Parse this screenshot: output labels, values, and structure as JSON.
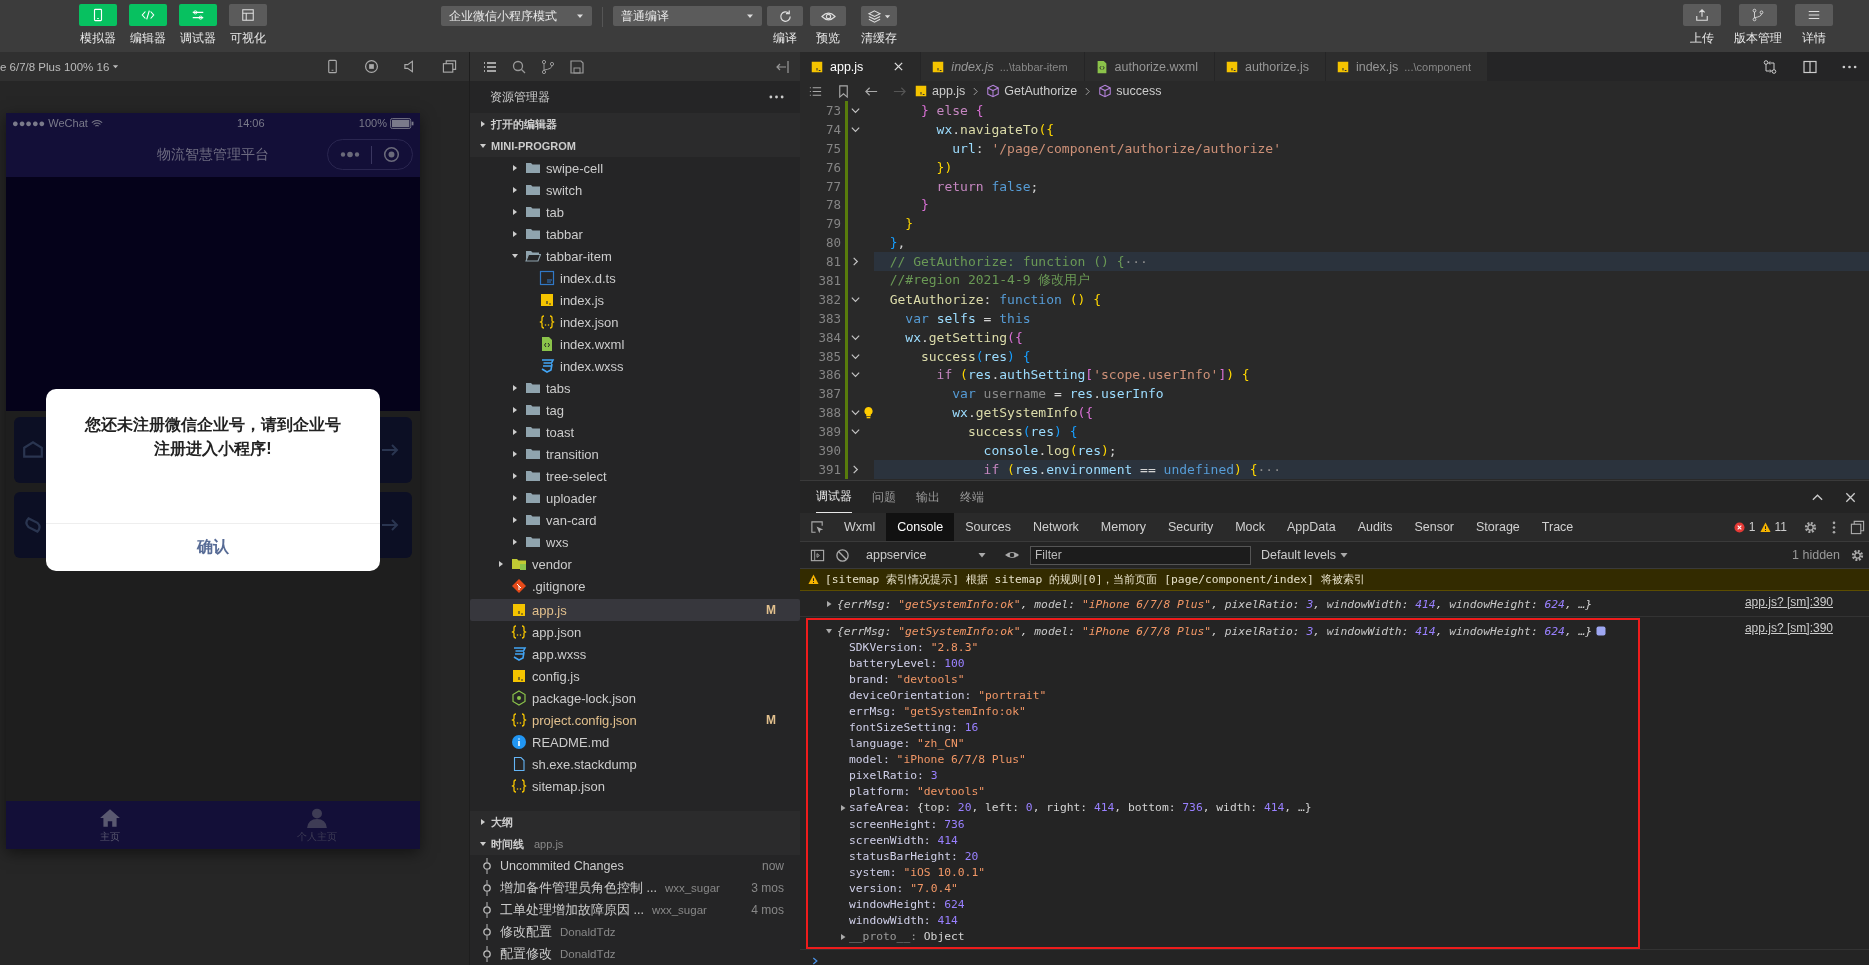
{
  "toolbar": {
    "views": [
      {
        "label": "模拟器",
        "selected": true
      },
      {
        "label": "编辑器",
        "selected": true
      },
      {
        "label": "调试器",
        "selected": true
      },
      {
        "label": "可视化",
        "selected": false
      }
    ],
    "mode_select": "企业微信小程序模式",
    "compile_select": "普通编译",
    "actions": [
      {
        "label": "编译"
      },
      {
        "label": "预览"
      },
      {
        "label": "清缓存"
      }
    ],
    "right_actions": [
      {
        "label": "上传"
      },
      {
        "label": "版本管理"
      },
      {
        "label": "详情"
      }
    ]
  },
  "simulator": {
    "device": "e 6/7/8 Plus 100% 16",
    "status": {
      "carrier": "●●●●● WeChat",
      "time": "14:06",
      "battery": "100%"
    },
    "nav_title": "物流智慧管理平台",
    "dialog": {
      "message": "您还未注册微信企业号，请到企业号注册进入小程序!",
      "button": "确认"
    },
    "tabbar": [
      {
        "label": "主页",
        "selected": true
      },
      {
        "label": "个人主页",
        "selected": false
      }
    ]
  },
  "explorer": {
    "title": "资源管理器",
    "open_editors": {
      "label": "打开的编辑器",
      "expanded": false
    },
    "project": {
      "label": "MINI-PROGROM",
      "expanded": true
    },
    "tree": [
      {
        "children": [
          {
            "label": "swipe-cell",
            "kind": "folder",
            "expanded": false,
            "selected": false
          },
          {
            "label": "switch",
            "kind": "folder",
            "expanded": false,
            "selected": false
          },
          {
            "label": "tab",
            "kind": "folder",
            "expanded": false,
            "selected": false
          },
          {
            "label": "tabbar",
            "kind": "folder",
            "expanded": false,
            "selected": false
          },
          {
            "label": "tabbar-item",
            "kind": "folder",
            "expanded": true,
            "selected": false,
            "children": [
              {
                "label": "index.d.ts",
                "kind": "ts",
                "selected": false
              },
              {
                "label": "index.js",
                "kind": "js",
                "selected": false
              },
              {
                "label": "index.json",
                "kind": "json",
                "selected": false
              },
              {
                "label": "index.wxml",
                "kind": "wxml",
                "selected": false
              },
              {
                "label": "index.wxss",
                "kind": "wxss",
                "selected": false
              }
            ]
          },
          {
            "label": "tabs",
            "kind": "folder",
            "expanded": false,
            "selected": false
          },
          {
            "label": "tag",
            "kind": "folder",
            "expanded": false,
            "selected": false
          },
          {
            "label": "toast",
            "kind": "folder",
            "expanded": false,
            "selected": false
          },
          {
            "label": "transition",
            "kind": "folder",
            "expanded": false,
            "selected": false
          },
          {
            "label": "tree-select",
            "kind": "folder",
            "expanded": false,
            "selected": false
          },
          {
            "label": "uploader",
            "kind": "folder",
            "expanded": false,
            "selected": false
          },
          {
            "label": "van-card",
            "kind": "folder",
            "expanded": false,
            "selected": false
          },
          {
            "label": "wxs",
            "kind": "folder",
            "expanded": false,
            "selected": false
          }
        ]
      },
      {
        "label": "vendor",
        "kind": "vendor",
        "expanded": false,
        "selected": false
      },
      {
        "label": ".gitignore",
        "kind": "git",
        "selected": false
      },
      {
        "label": "app.js",
        "kind": "js",
        "selected": true,
        "status": "M"
      },
      {
        "label": "app.json",
        "kind": "json",
        "selected": false
      },
      {
        "label": "app.wxss",
        "kind": "wxss",
        "selected": false
      },
      {
        "label": "config.js",
        "kind": "js",
        "selected": false
      },
      {
        "label": "package-lock.json",
        "kind": "node",
        "selected": false
      },
      {
        "label": "project.config.json",
        "kind": "json",
        "selected": false,
        "status": "M"
      },
      {
        "label": "README.md",
        "kind": "info",
        "selected": false
      },
      {
        "label": "sh.exe.stackdump",
        "kind": "doc",
        "selected": false
      },
      {
        "label": "sitemap.json",
        "kind": "json",
        "selected": false
      }
    ],
    "outline": {
      "label": "大纲",
      "expanded": false
    },
    "timeline": {
      "label": "时间线",
      "file": "app.js",
      "expanded": true,
      "entries": [
        {
          "title": "Uncommited Changes",
          "time": "now"
        },
        {
          "title": "增加备件管理员角色控制 ...",
          "author": "wxx_sugar",
          "time": "3 mos"
        },
        {
          "title": "工单处理增加故障原因 ...",
          "author": "wxx_sugar",
          "time": "4 mos"
        },
        {
          "title": "修改配置",
          "author": "DonaldTdz"
        },
        {
          "title": "配置修改",
          "author": "DonaldTdz"
        }
      ]
    }
  },
  "editor": {
    "tabs": [
      {
        "label": "app.js",
        "kind": "js",
        "selected": true,
        "preview": false
      },
      {
        "label": "index.js",
        "path": "...\\tabbar-item",
        "kind": "js",
        "selected": false,
        "preview": true
      },
      {
        "label": "authorize.wxml",
        "kind": "wxml",
        "selected": false,
        "preview": false
      },
      {
        "label": "authorize.js",
        "kind": "js",
        "selected": false,
        "preview": false
      },
      {
        "label": "index.js",
        "path": "...\\component",
        "kind": "js",
        "selected": false,
        "preview": false
      }
    ],
    "breadcrumb": [
      {
        "label": "app.js",
        "kind": "js"
      },
      {
        "label": "GetAuthorize",
        "kind": "cube"
      },
      {
        "label": "success",
        "kind": "cube"
      }
    ],
    "lines": [
      {
        "number": "73",
        "expanded": true,
        "highlighted": false,
        "tokens": [
          {
            "text": "      }",
            "kind": "b2"
          },
          {
            "text": " else ",
            "kind": "kw"
          },
          {
            "text": "{",
            "kind": "b2"
          }
        ]
      },
      {
        "number": "74",
        "expanded": true,
        "highlighted": false,
        "tokens": [
          {
            "text": "        wx",
            "kind": "v"
          },
          {
            "text": ".",
            "kind": "p"
          },
          {
            "text": "navigateTo",
            "kind": "f"
          },
          {
            "text": "({",
            "kind": "b1"
          }
        ]
      },
      {
        "number": "75",
        "highlighted": false,
        "tokens": [
          {
            "text": "          url",
            "kind": "v"
          },
          {
            "text": ": ",
            "kind": "p"
          },
          {
            "text": "'/page/component/authorize/authorize'",
            "kind": "s"
          }
        ]
      },
      {
        "number": "76",
        "highlighted": false,
        "tokens": [
          {
            "text": "        })",
            "kind": "b1"
          }
        ]
      },
      {
        "number": "77",
        "highlighted": false,
        "tokens": [
          {
            "text": "        return ",
            "kind": "kw"
          },
          {
            "text": "false",
            "kind": "st"
          },
          {
            "text": ";",
            "kind": "p"
          }
        ]
      },
      {
        "number": "78",
        "highlighted": false,
        "tokens": [
          {
            "text": "      }",
            "kind": "b2"
          }
        ]
      },
      {
        "number": "79",
        "highlighted": false,
        "tokens": [
          {
            "text": "    }",
            "kind": "b1"
          }
        ]
      },
      {
        "number": "80",
        "highlighted": false,
        "tokens": [
          {
            "text": "  }",
            "kind": "b3"
          },
          {
            "text": ",",
            "kind": "p"
          }
        ]
      },
      {
        "number": "81",
        "expanded": false,
        "highlighted": true,
        "tokens": [
          {
            "text": "  // GetAuthorize: function () {",
            "kind": "c"
          },
          {
            "text": "···",
            "kind": "e"
          }
        ]
      },
      {
        "number": "381",
        "highlighted": false,
        "tokens": [
          {
            "text": "  //#region 2021-4-9 修改用户",
            "kind": "c"
          }
        ]
      },
      {
        "number": "382",
        "expanded": true,
        "highlighted": false,
        "tokens": [
          {
            "text": "  GetAuthorize",
            "kind": "f"
          },
          {
            "text": ": ",
            "kind": "p"
          },
          {
            "text": "function ",
            "kind": "st"
          },
          {
            "text": "() {",
            "kind": "b1"
          }
        ]
      },
      {
        "number": "383",
        "highlighted": false,
        "tokens": [
          {
            "text": "    var ",
            "kind": "st"
          },
          {
            "text": "selfs",
            "kind": "v"
          },
          {
            "text": " = ",
            "kind": "p"
          },
          {
            "text": "this",
            "kind": "st"
          }
        ]
      },
      {
        "number": "384",
        "expanded": true,
        "highlighted": false,
        "tokens": [
          {
            "text": "    wx",
            "kind": "v"
          },
          {
            "text": ".",
            "kind": "p"
          },
          {
            "text": "getSetting",
            "kind": "f"
          },
          {
            "text": "({",
            "kind": "b2"
          }
        ]
      },
      {
        "number": "385",
        "expanded": true,
        "highlighted": false,
        "tokens": [
          {
            "text": "      success",
            "kind": "f"
          },
          {
            "text": "(",
            "kind": "b3"
          },
          {
            "text": "res",
            "kind": "v"
          },
          {
            "text": ") {",
            "kind": "b3"
          }
        ]
      },
      {
        "number": "386",
        "expanded": true,
        "highlighted": false,
        "tokens": [
          {
            "text": "        if ",
            "kind": "kw"
          },
          {
            "text": "(",
            "kind": "b1"
          },
          {
            "text": "res",
            "kind": "v"
          },
          {
            "text": ".",
            "kind": "p"
          },
          {
            "text": "authSetting",
            "kind": "v"
          },
          {
            "text": "[",
            "kind": "b2"
          },
          {
            "text": "'scope.userInfo'",
            "kind": "s"
          },
          {
            "text": "]",
            "kind": "b2"
          },
          {
            "text": ") {",
            "kind": "b1"
          }
        ]
      },
      {
        "number": "387",
        "highlighted": false,
        "tokens": [
          {
            "text": "          var ",
            "kind": "st"
          },
          {
            "text": "username",
            "kind": "d"
          },
          {
            "text": " = ",
            "kind": "p"
          },
          {
            "text": "res",
            "kind": "v"
          },
          {
            "text": ".",
            "kind": "p"
          },
          {
            "text": "userInfo",
            "kind": "v"
          }
        ]
      },
      {
        "number": "388",
        "expanded": true,
        "lightbulb": true,
        "highlighted": false,
        "tokens": [
          {
            "text": "          wx",
            "kind": "v"
          },
          {
            "text": ".",
            "kind": "p"
          },
          {
            "text": "getSystemInfo",
            "kind": "f"
          },
          {
            "text": "({",
            "kind": "b2"
          }
        ]
      },
      {
        "number": "389",
        "expanded": true,
        "highlighted": false,
        "tokens": [
          {
            "text": "            success",
            "kind": "f"
          },
          {
            "text": "(",
            "kind": "b3"
          },
          {
            "text": "res",
            "kind": "v"
          },
          {
            "text": ") {",
            "kind": "b3"
          }
        ]
      },
      {
        "number": "390",
        "highlighted": false,
        "tokens": [
          {
            "text": "              console",
            "kind": "v"
          },
          {
            "text": ".",
            "kind": "p"
          },
          {
            "text": "log",
            "kind": "f"
          },
          {
            "text": "(",
            "kind": "b1"
          },
          {
            "text": "res",
            "kind": "v"
          },
          {
            "text": ")",
            "kind": "b1"
          },
          {
            "text": ";",
            "kind": "p"
          }
        ]
      },
      {
        "number": "391",
        "expanded": false,
        "highlighted": true,
        "tokens": [
          {
            "text": "              if ",
            "kind": "kw"
          },
          {
            "text": "(",
            "kind": "b1"
          },
          {
            "text": "res",
            "kind": "v"
          },
          {
            "text": ".",
            "kind": "p"
          },
          {
            "text": "environment",
            "kind": "v"
          },
          {
            "text": " == ",
            "kind": "p"
          },
          {
            "text": "undefined",
            "kind": "st"
          },
          {
            "text": ") {",
            "kind": "b1"
          },
          {
            "text": "···",
            "kind": "e"
          }
        ]
      }
    ]
  },
  "panel": {
    "tabs": [
      {
        "label": "调试器",
        "selected": true
      },
      {
        "label": "问题",
        "selected": false
      },
      {
        "label": "输出",
        "selected": false
      },
      {
        "label": "终端",
        "selected": false
      }
    ],
    "devtools_tabs": [
      {
        "label": "Wxml",
        "selected": false
      },
      {
        "label": "Console",
        "selected": true
      },
      {
        "label": "Sources",
        "selected": false
      },
      {
        "label": "Network",
        "selected": false
      },
      {
        "label": "Memory",
        "selected": false
      },
      {
        "label": "Security",
        "selected": false
      },
      {
        "label": "Mock",
        "selected": false
      },
      {
        "label": "AppData",
        "selected": false
      },
      {
        "label": "Audits",
        "selected": false
      },
      {
        "label": "Sensor",
        "selected": false
      },
      {
        "label": "Storage",
        "selected": false
      },
      {
        "label": "Trace",
        "selected": false
      }
    ],
    "errors": "1",
    "warnings": "11",
    "context": "appservice",
    "filter": {
      "placeholder": "Filter"
    },
    "levels": "Default levels",
    "hidden": "1 hidden",
    "messages": [
      {
        "kind": "warning",
        "text": "[sitemap 索引情况提示] 根据 sitemap 的规则[0]，当前页面 [page/component/index] 将被索引"
      },
      {
        "kind": "object",
        "expanded": false,
        "outlined": false,
        "source": "app.js? [sm]:390",
        "tokens": [
          {
            "text": "{",
            "kind": "p"
          },
          {
            "text": "errMsg",
            "kind": "k"
          },
          {
            "text": ": ",
            "kind": "p"
          },
          {
            "text": "\"getSystemInfo:ok\"",
            "kind": "s"
          },
          {
            "text": ", ",
            "kind": "p"
          },
          {
            "text": "model",
            "kind": "k"
          },
          {
            "text": ": ",
            "kind": "p"
          },
          {
            "text": "\"iPhone 6/7/8 Plus\"",
            "kind": "s"
          },
          {
            "text": ", ",
            "kind": "p"
          },
          {
            "text": "pixelRatio",
            "kind": "k"
          },
          {
            "text": ": ",
            "kind": "p"
          },
          {
            "text": "3",
            "kind": "n"
          },
          {
            "text": ", ",
            "kind": "p"
          },
          {
            "text": "windowWidth",
            "kind": "k"
          },
          {
            "text": ": ",
            "kind": "p"
          },
          {
            "text": "414",
            "kind": "n"
          },
          {
            "text": ", ",
            "kind": "p"
          },
          {
            "text": "windowHeight",
            "kind": "k"
          },
          {
            "text": ": ",
            "kind": "p"
          },
          {
            "text": "624",
            "kind": "n"
          },
          {
            "text": ", …}",
            "kind": "p"
          }
        ]
      },
      {
        "kind": "object",
        "expanded": true,
        "outlined": true,
        "source": "app.js? [sm]:390",
        "tokens": [
          {
            "text": "{",
            "kind": "p"
          },
          {
            "text": "errMsg",
            "kind": "k"
          },
          {
            "text": ": ",
            "kind": "p"
          },
          {
            "text": "\"getSystemInfo:ok\"",
            "kind": "s"
          },
          {
            "text": ", ",
            "kind": "p"
          },
          {
            "text": "model",
            "kind": "k"
          },
          {
            "text": ": ",
            "kind": "p"
          },
          {
            "text": "\"iPhone 6/7/8 Plus\"",
            "kind": "s"
          },
          {
            "text": ", ",
            "kind": "p"
          },
          {
            "text": "pixelRatio",
            "kind": "k"
          },
          {
            "text": ": ",
            "kind": "p"
          },
          {
            "text": "3",
            "kind": "n"
          },
          {
            "text": ", ",
            "kind": "p"
          },
          {
            "text": "windowWidth",
            "kind": "k"
          },
          {
            "text": ": ",
            "kind": "p"
          },
          {
            "text": "414",
            "kind": "n"
          },
          {
            "text": ", ",
            "kind": "p"
          },
          {
            "text": "windowHeight",
            "kind": "k"
          },
          {
            "text": ": ",
            "kind": "p"
          },
          {
            "text": "624",
            "kind": "n"
          },
          {
            "text": ", …}",
            "kind": "p"
          }
        ],
        "properties": [
          {
            "key": "SDKVersion:",
            "kind": "value",
            "tokens": [
              {
                "text": " \"2.8.3\"",
                "kind": "s"
              }
            ]
          },
          {
            "key": "batteryLevel:",
            "kind": "value",
            "tokens": [
              {
                "text": " 100",
                "kind": "n"
              }
            ]
          },
          {
            "key": "brand:",
            "kind": "value",
            "tokens": [
              {
                "text": " \"devtools\"",
                "kind": "s"
              }
            ]
          },
          {
            "key": "deviceOrientation:",
            "kind": "value",
            "tokens": [
              {
                "text": " \"portrait\"",
                "kind": "s"
              }
            ]
          },
          {
            "key": "errMsg:",
            "kind": "value",
            "tokens": [
              {
                "text": " \"getSystemInfo:ok\"",
                "kind": "s"
              }
            ]
          },
          {
            "key": "fontSizeSetting:",
            "kind": "value",
            "tokens": [
              {
                "text": " 16",
                "kind": "n"
              }
            ]
          },
          {
            "key": "language:",
            "kind": "value",
            "tokens": [
              {
                "text": " \"zh_CN\"",
                "kind": "s"
              }
            ]
          },
          {
            "key": "model:",
            "kind": "value",
            "tokens": [
              {
                "text": " \"iPhone 6/7/8 Plus\"",
                "kind": "s"
              }
            ]
          },
          {
            "key": "pixelRatio:",
            "kind": "value",
            "tokens": [
              {
                "text": " 3",
                "kind": "n"
              }
            ]
          },
          {
            "key": "platform:",
            "kind": "value",
            "tokens": [
              {
                "text": " \"devtools\"",
                "kind": "s"
              }
            ]
          },
          {
            "key": "safeArea:",
            "kind": "object",
            "expanded": false,
            "tokens": [
              {
                "text": " {top: ",
                "kind": "p"
              },
              {
                "text": "20",
                "kind": "n"
              },
              {
                "text": ", left: ",
                "kind": "p"
              },
              {
                "text": "0",
                "kind": "n"
              },
              {
                "text": ", right: ",
                "kind": "p"
              },
              {
                "text": "414",
                "kind": "n"
              },
              {
                "text": ", bottom: ",
                "kind": "p"
              },
              {
                "text": "736",
                "kind": "n"
              },
              {
                "text": ", width: ",
                "kind": "p"
              },
              {
                "text": "414",
                "kind": "n"
              },
              {
                "text": ", …}",
                "kind": "p"
              }
            ]
          },
          {
            "key": "screenHeight:",
            "kind": "value",
            "tokens": [
              {
                "text": " 736",
                "kind": "n"
              }
            ]
          },
          {
            "key": "screenWidth:",
            "kind": "value",
            "tokens": [
              {
                "text": " 414",
                "kind": "n"
              }
            ]
          },
          {
            "key": "statusBarHeight:",
            "kind": "value",
            "tokens": [
              {
                "text": " 20",
                "kind": "n"
              }
            ]
          },
          {
            "key": "system:",
            "kind": "value",
            "tokens": [
              {
                "text": " \"iOS 10.0.1\"",
                "kind": "s"
              }
            ]
          },
          {
            "key": "version:",
            "kind": "value",
            "tokens": [
              {
                "text": " \"7.0.4\"",
                "kind": "s"
              }
            ]
          },
          {
            "key": "windowHeight:",
            "kind": "value",
            "tokens": [
              {
                "text": " 624",
                "kind": "n"
              }
            ]
          },
          {
            "key": "windowWidth:",
            "kind": "value",
            "tokens": [
              {
                "text": " 414",
                "kind": "n"
              }
            ]
          },
          {
            "key": "__proto__:",
            "kind": "proto",
            "expanded": false,
            "tokens": [
              {
                "text": " Object",
                "kind": "p"
              }
            ]
          }
        ]
      }
    ]
  }
}
